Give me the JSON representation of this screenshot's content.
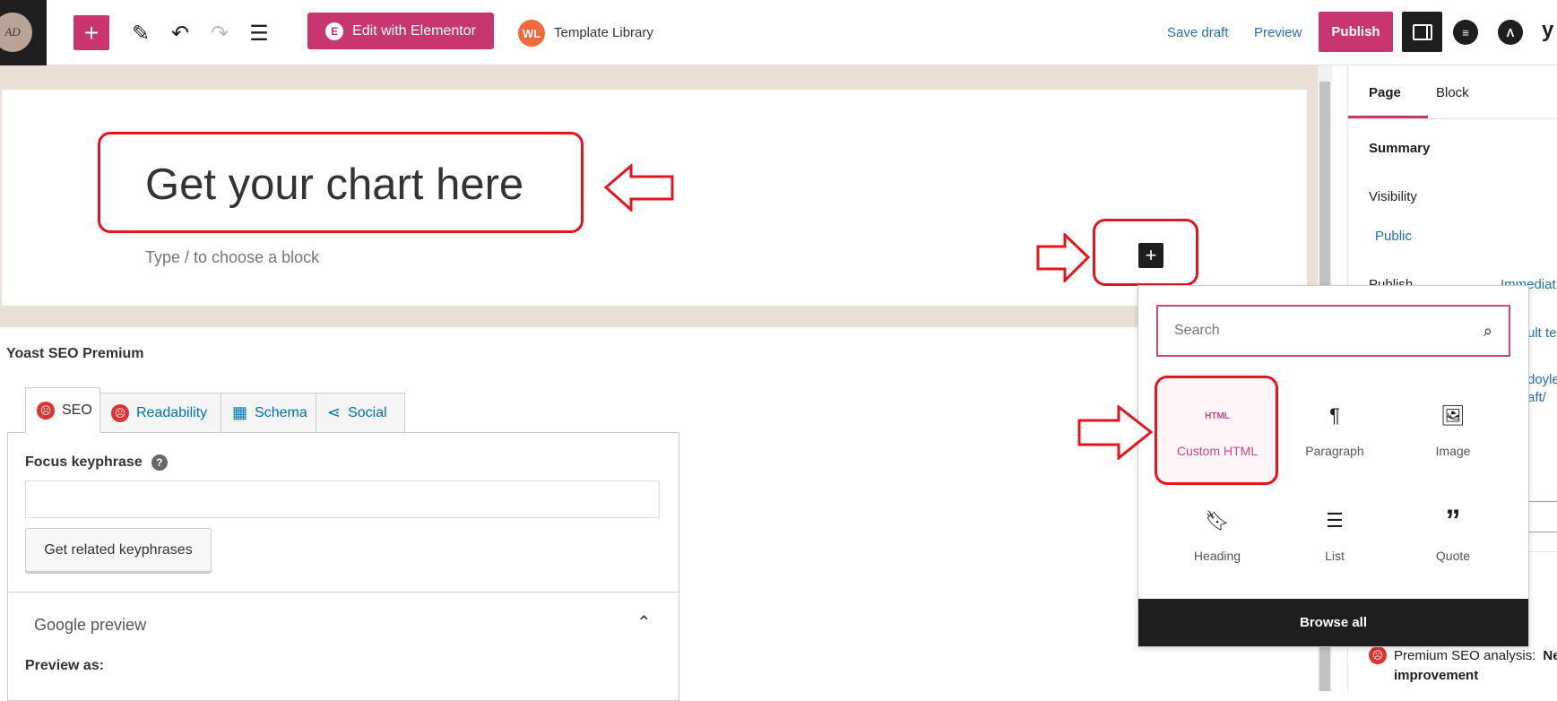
{
  "topbar": {
    "logo_text": "AD",
    "add_block_icon": "plus-icon",
    "tools_icon": "pencil-icon",
    "undo_icon": "undo-icon",
    "redo_icon": "redo-icon",
    "list_view_icon": "list-view-icon",
    "elementor_label": "Edit with Elementor",
    "template_library_logo": "WL",
    "template_library_label": "Template Library",
    "save_draft": "Save draft",
    "preview": "Preview",
    "publish": "Publish"
  },
  "editor": {
    "title": "Get your chart here",
    "placeholder": "Type / to choose a block"
  },
  "inserter": {
    "search_placeholder": "Search",
    "items": [
      {
        "label": "Custom HTML",
        "icon": "HTML"
      },
      {
        "label": "Paragraph",
        "icon": "¶"
      },
      {
        "label": "Image",
        "icon": "image-icon"
      },
      {
        "label": "Heading",
        "icon": "bookmark-icon"
      },
      {
        "label": "List",
        "icon": "list-icon"
      },
      {
        "label": "Quote",
        "icon": "quote-icon"
      }
    ],
    "browse_all": "Browse all"
  },
  "sidebar": {
    "tabs": [
      "Page",
      "Block"
    ],
    "summary": "Summary",
    "visibility_label": "Visibility",
    "visibility_value": "Public",
    "publish_label": "Publish",
    "publish_value": "Immediat",
    "template_partial": "ult te",
    "url_partial_1": "doyle",
    "url_partial_2": "aft/",
    "seo_analysis": "Premium SEO analysis:",
    "seo_analysis_value": "Ne",
    "seo_analysis_line2": "improvement"
  },
  "yoast": {
    "title": "Yoast SEO Premium",
    "tabs": [
      "SEO",
      "Readability",
      "Schema",
      "Social"
    ],
    "focus_label": "Focus keyphrase",
    "focus_value": "",
    "related_button": "Get related keyphrases",
    "google_preview": "Google preview",
    "preview_as": "Preview as:"
  },
  "colors": {
    "accent": "#c8366f",
    "annotation": "#e3161f",
    "link": "#2271b1"
  }
}
